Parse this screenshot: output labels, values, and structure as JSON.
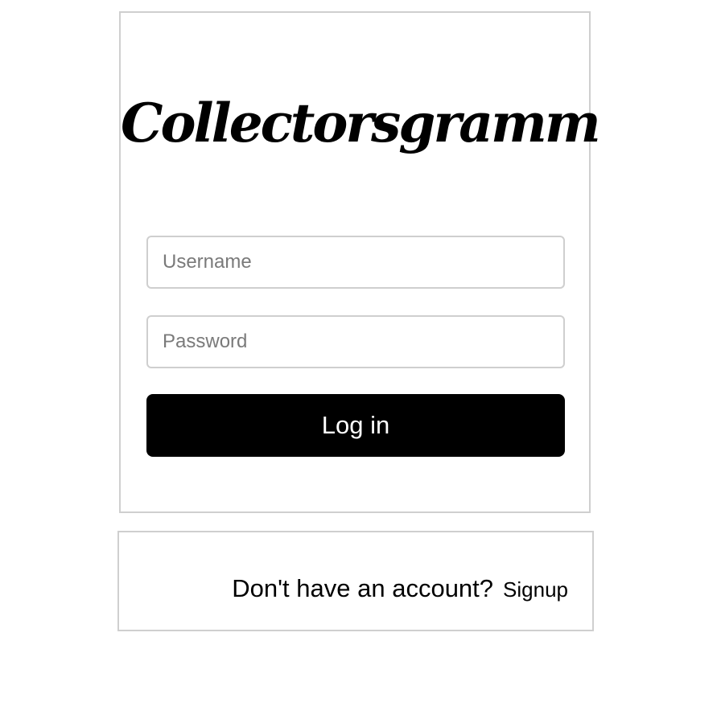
{
  "brand": {
    "logo_text": "Collectorsgramm"
  },
  "login_form": {
    "username_placeholder": "Username",
    "username_value": "",
    "password_placeholder": "Password",
    "password_value": "",
    "login_button_label": "Log in"
  },
  "signup": {
    "prompt": "Don't have an account?",
    "link_label": "Signup"
  },
  "colors": {
    "button_background": "#000000",
    "button_text": "#ffffff",
    "border": "#cfcfcf",
    "placeholder": "#7a7a7a"
  }
}
